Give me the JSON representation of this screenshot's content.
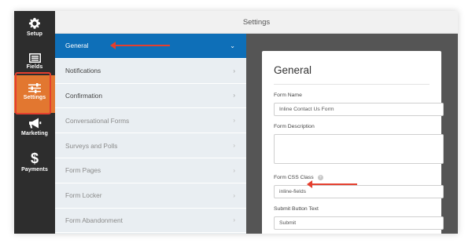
{
  "window": {
    "title": "Settings"
  },
  "rail": {
    "items": [
      {
        "label": "Setup",
        "icon": "gear-icon"
      },
      {
        "label": "Fields",
        "icon": "form-fields-icon"
      },
      {
        "label": "Settings",
        "icon": "sliders-icon"
      },
      {
        "label": "Marketing",
        "icon": "megaphone-icon"
      },
      {
        "label": "Payments",
        "icon": "dollar-icon"
      }
    ],
    "active_color": "#e27730",
    "background": "#2d2d2d"
  },
  "nav": {
    "items": [
      {
        "label": "General",
        "chevron": "⌄"
      },
      {
        "label": "Notifications",
        "chevron": "›"
      },
      {
        "label": "Confirmation",
        "chevron": "›"
      },
      {
        "label": "Conversational Forms",
        "chevron": "›"
      },
      {
        "label": "Surveys and Polls",
        "chevron": "›"
      },
      {
        "label": "Form Pages",
        "chevron": "›"
      },
      {
        "label": "Form Locker",
        "chevron": "›"
      },
      {
        "label": "Form Abandonment",
        "chevron": "›"
      }
    ],
    "active_color": "#0e6fb8"
  },
  "panel": {
    "title": "General",
    "form_name_label": "Form Name",
    "form_name_value": "Inline Contact Us Form",
    "form_description_label": "Form Description",
    "form_description_value": "",
    "css_class_label": "Form CSS Class",
    "css_class_help_icon": "question-icon",
    "css_class_value": "inline-fields",
    "submit_text_label": "Submit Button Text",
    "submit_text_value": "Submit"
  },
  "annotation_color": "#e53f2e"
}
